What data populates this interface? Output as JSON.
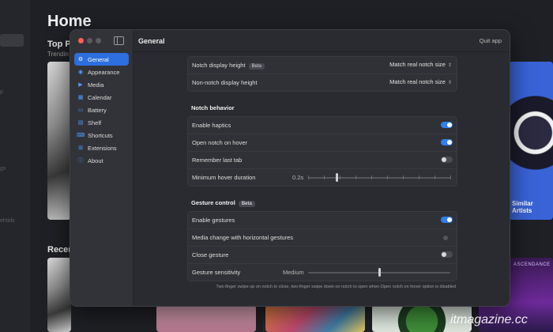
{
  "background_app": {
    "sidebar_fragments": [
      "p",
      "gs",
      "ehtids"
    ],
    "home_title": "Home",
    "top_label": "Top Pi",
    "top_sub": "Trendin",
    "recent_label": "Recen",
    "similar_artists": "Similar Artists",
    "banner_text": "ASCENDANCE"
  },
  "window": {
    "title": "General",
    "quit_label": "Quit app"
  },
  "sidebar": {
    "items": [
      {
        "label": "General",
        "icon": "gear-icon",
        "glyph": "⚙",
        "active": true
      },
      {
        "label": "Appearance",
        "icon": "eye-icon",
        "glyph": "◉",
        "active": false
      },
      {
        "label": "Media",
        "icon": "media-icon",
        "glyph": "▶",
        "active": false
      },
      {
        "label": "Calendar",
        "icon": "calendar-icon",
        "glyph": "▦",
        "active": false
      },
      {
        "label": "Battery",
        "icon": "battery-icon",
        "glyph": "▭",
        "active": false
      },
      {
        "label": "Shelf",
        "icon": "shelf-icon",
        "glyph": "▤",
        "active": false
      },
      {
        "label": "Shortcuts",
        "icon": "keyboard-icon",
        "glyph": "⌨",
        "active": false
      },
      {
        "label": "Extensions",
        "icon": "extensions-icon",
        "glyph": "⊞",
        "active": false
      },
      {
        "label": "About",
        "icon": "info-icon",
        "glyph": "ⓘ",
        "active": false
      }
    ]
  },
  "display": {
    "notch_height_label": "Notch display height",
    "beta_badge": "Beta",
    "notch_height_value": "Match real notch size",
    "non_notch_label": "Non-notch display height",
    "non_notch_value": "Match real notch size"
  },
  "notch_behavior": {
    "heading": "Notch behavior",
    "enable_haptics": {
      "label": "Enable haptics",
      "on": true
    },
    "open_on_hover": {
      "label": "Open notch on hover",
      "on": true
    },
    "remember_last_tab": {
      "label": "Remember last tab",
      "on": false
    },
    "min_hover": {
      "label": "Minimum hover duration",
      "value": "0.2s",
      "fraction": 0.2
    }
  },
  "gesture_control": {
    "heading": "Gesture control",
    "beta_badge": "Beta",
    "enable_gestures": {
      "label": "Enable gestures",
      "on": true
    },
    "media_change": {
      "label": "Media change with horizontal gestures",
      "enabled": false
    },
    "close_gesture": {
      "label": "Close gesture",
      "on": false
    },
    "sensitivity": {
      "label": "Gesture sensitivity",
      "value": "Medium",
      "fraction": 0.5
    },
    "footnote": "Two-finger swipe up on notch to close, two-finger swipe down on notch to open when Open notch on hover option is disabled"
  },
  "watermark": "itmagazine.cc",
  "colors": {
    "accent": "#2d6ee0",
    "toggle_on": "#2f7ff0",
    "close_button": "#ff5f57"
  }
}
